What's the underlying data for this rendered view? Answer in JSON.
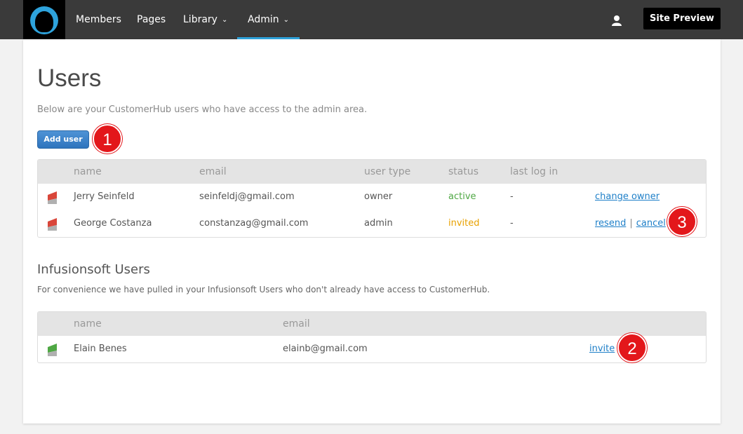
{
  "nav": {
    "items": [
      {
        "label": "Members",
        "dropdown": false
      },
      {
        "label": "Pages",
        "dropdown": false
      },
      {
        "label": "Library",
        "dropdown": true
      },
      {
        "label": "Admin",
        "dropdown": true,
        "active": true
      }
    ],
    "site_preview_label": "Site Preview",
    "accent_color": "#2ea3dc"
  },
  "page": {
    "title": "Users",
    "subtitle": "Below are your CustomerHub users who have access to the admin area.",
    "add_user_label": "Add user"
  },
  "users_table": {
    "headers": [
      "name",
      "email",
      "user type",
      "status",
      "last log in"
    ],
    "rows": [
      {
        "name": "Jerry Seinfeld",
        "email": "seinfeldj@gmail.com",
        "user_type": "owner",
        "status": "active",
        "last_login": "-",
        "actions": [
          "change owner"
        ]
      },
      {
        "name": "George Costanza",
        "email": "constanzag@gmail.com",
        "user_type": "admin",
        "status": "invited",
        "last_login": "-",
        "actions": [
          "resend",
          "cancel"
        ],
        "action_separator": "|"
      }
    ]
  },
  "infusionsoft": {
    "title": "Infusionsoft Users",
    "subtitle": "For convenience we have pulled in your Infusionsoft Users who don't already have access to CustomerHub.",
    "headers": [
      "name",
      "email"
    ],
    "rows": [
      {
        "name": "Elain Benes",
        "email": "elainb@gmail.com",
        "action": "invite"
      }
    ]
  },
  "callouts": [
    "1",
    "2",
    "3"
  ],
  "colors": {
    "active": "#4fa844",
    "invited": "#e8a100",
    "link": "#1e7fc8",
    "callout": "#e3171b"
  }
}
